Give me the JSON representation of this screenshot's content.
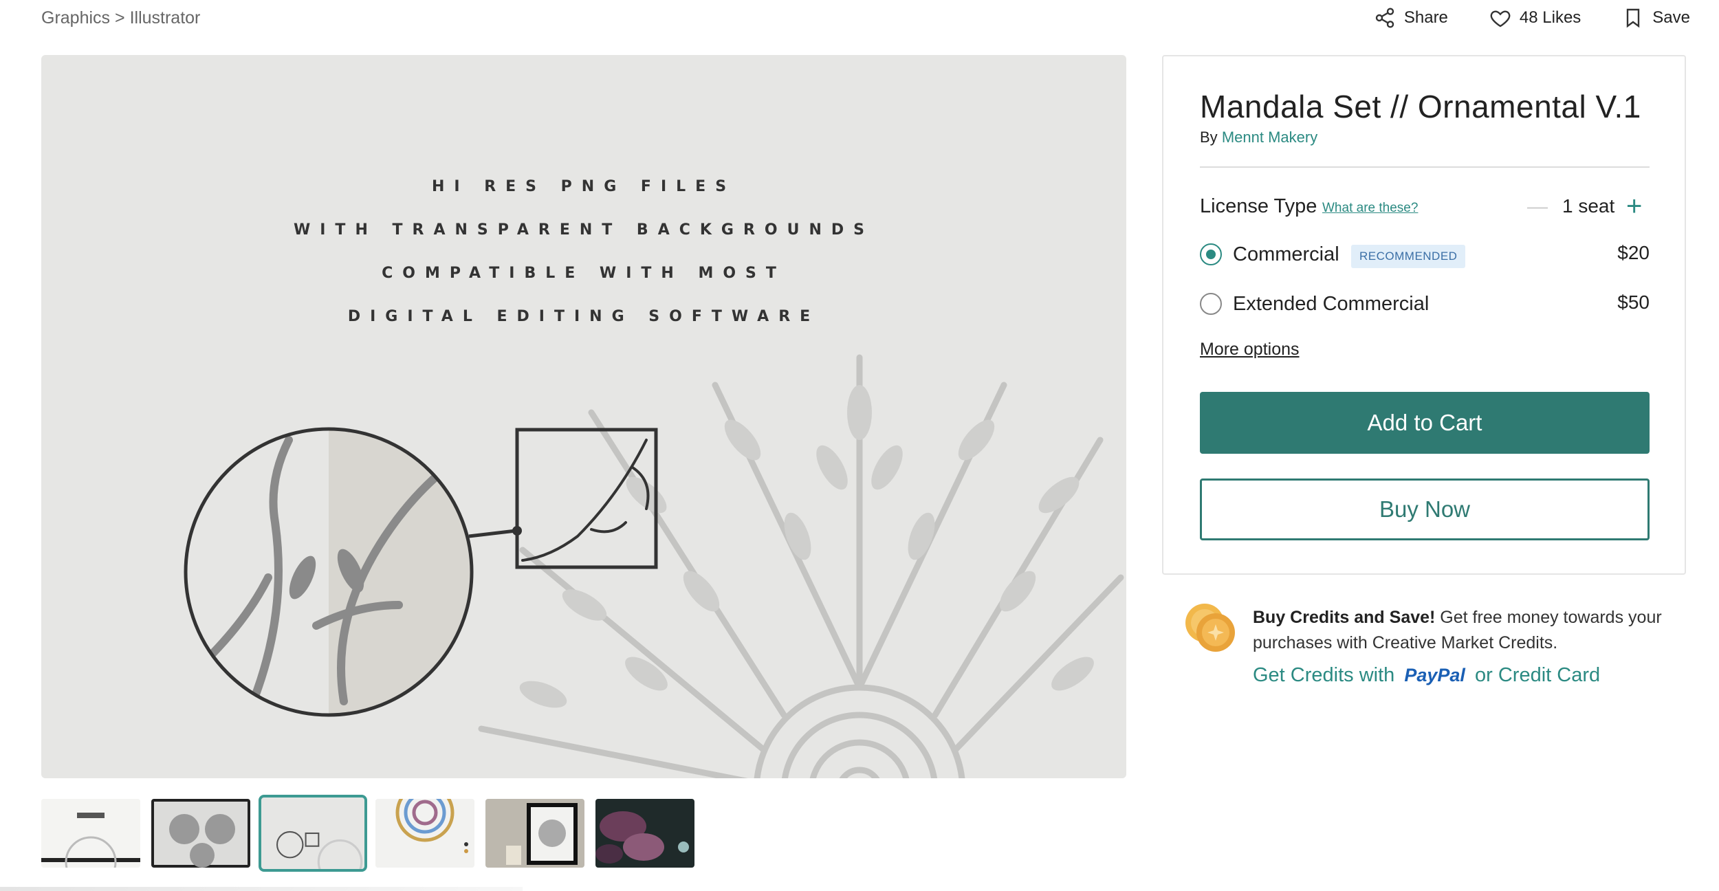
{
  "breadcrumb": {
    "category": "Graphics",
    "separator": ">",
    "subcategory": "Illustrator"
  },
  "top_actions": {
    "share": "Share",
    "likes": "48 Likes",
    "save": "Save"
  },
  "hero": {
    "lines": [
      "HI RES PNG FILES",
      "WITH TRANSPARENT BACKGROUNDS",
      "COMPATIBLE WITH MOST",
      "DIGITAL EDITING SOFTWARE"
    ]
  },
  "thumbnails": [
    {
      "name": "thumb-cover",
      "active": false
    },
    {
      "name": "thumb-mandalas-frame",
      "active": false
    },
    {
      "name": "thumb-png-info",
      "active": true
    },
    {
      "name": "thumb-colored-mandala",
      "active": false
    },
    {
      "name": "thumb-frame-mockup",
      "active": false
    },
    {
      "name": "thumb-dark-flowers",
      "active": false
    }
  ],
  "product": {
    "title": "Mandala Set // Ornamental V.1",
    "by_label": "By",
    "author": "Mennt Makery"
  },
  "license": {
    "label": "License Type",
    "help_link": "What are these?",
    "seat_minus": "—",
    "seats": "1 seat",
    "seat_plus": "+",
    "options": [
      {
        "label": "Commercial",
        "badge": "RECOMMENDED",
        "price": "$20",
        "selected": true
      },
      {
        "label": "Extended Commercial",
        "badge": "",
        "price": "$50",
        "selected": false
      }
    ],
    "more_options": "More options"
  },
  "buttons": {
    "add_to_cart": "Add to Cart",
    "buy_now": "Buy Now"
  },
  "credits": {
    "headline": "Buy Credits and Save!",
    "body": " Get free money towards your purchases with Creative Market Credits.",
    "link_prefix": "Get Credits with",
    "paypal": "PayPal",
    "link_suffix": "or Credit Card"
  },
  "colors": {
    "accent": "#2f7a72",
    "link": "#2b8a82",
    "badge_bg": "#e1eef9"
  }
}
